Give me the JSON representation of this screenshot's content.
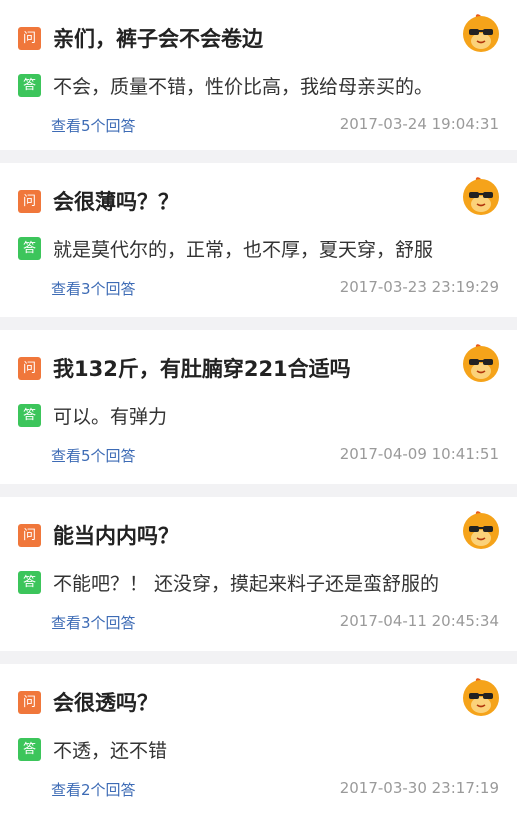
{
  "labels": {
    "question_badge": "问",
    "answer_badge": "答"
  },
  "colors": {
    "question_badge": "#f0773b",
    "answer_badge": "#3cc55b",
    "link": "#3d6bb5",
    "time": "#9a9a9a"
  },
  "items": [
    {
      "question": "亲们，裤子会不会卷边",
      "answer": "不会，质量不错，性价比高，我给母亲买的。",
      "view_answers": "查看5个回答",
      "time": "2017-03-24 19:04:31",
      "avatar_icon": "sunglasses-mascot-icon"
    },
    {
      "question": "会很薄吗？？",
      "answer": "就是莫代尔的，正常，也不厚，夏天穿，舒服",
      "view_answers": "查看3个回答",
      "time": "2017-03-23 23:19:29",
      "avatar_icon": "sunglasses-mascot-icon"
    },
    {
      "question": "我132斤，有肚腩穿221合适吗",
      "answer": "可以。有弹力",
      "view_answers": "查看5个回答",
      "time": "2017-04-09 10:41:51",
      "avatar_icon": "sunglasses-mascot-icon"
    },
    {
      "question": "能当内内吗？",
      "answer": "不能吧？！ 还没穿，摸起来料子还是蛮舒服的",
      "view_answers": "查看3个回答",
      "time": "2017-04-11 20:45:34",
      "avatar_icon": "sunglasses-mascot-icon"
    },
    {
      "question": "会很透吗？",
      "answer": "不透，还不错",
      "view_answers": "查看2个回答",
      "time": "2017-03-30 23:17:19",
      "avatar_icon": "sunglasses-mascot-icon"
    }
  ]
}
